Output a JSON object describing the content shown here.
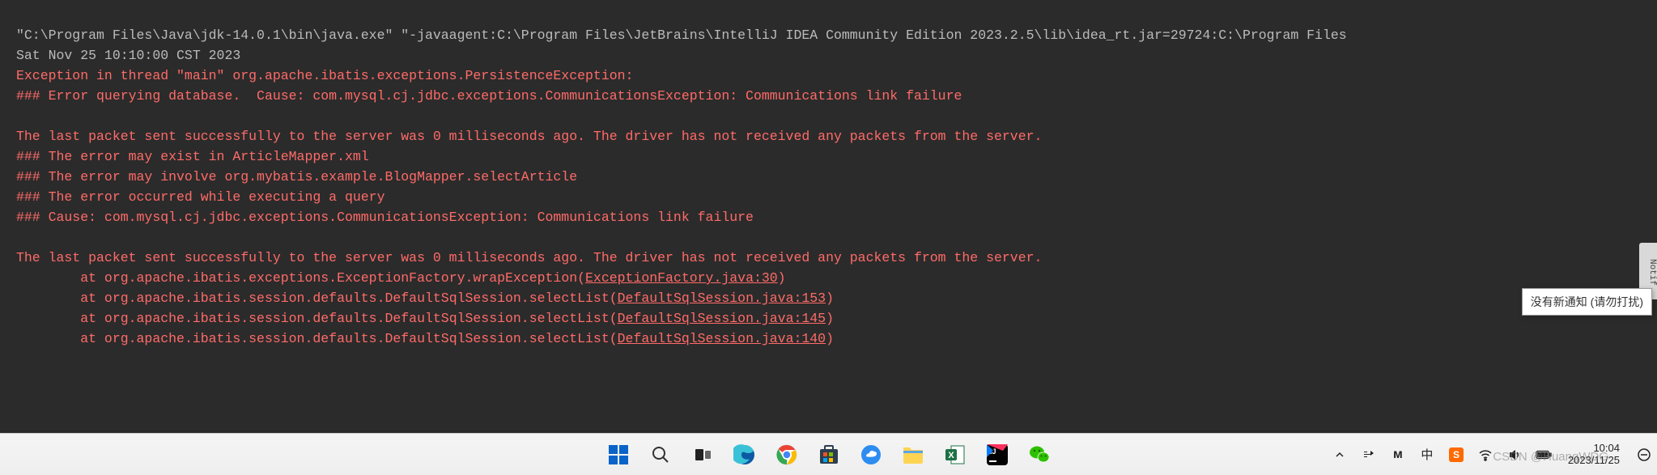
{
  "console": {
    "cmd": "\"C:\\Program Files\\Java\\jdk-14.0.1\\bin\\java.exe\" \"-javaagent:C:\\Program Files\\JetBrains\\IntelliJ IDEA Community Edition 2023.2.5\\lib\\idea_rt.jar=29724:C:\\Program Files",
    "ts": "Sat Nov 25 10:10:00 CST 2023",
    "err1": "Exception in thread \"main\" org.apache.ibatis.exceptions.PersistenceException: ",
    "err2": "### Error querying database.  Cause: com.mysql.cj.jdbc.exceptions.CommunicationsException: Communications link failure",
    "err3": "The last packet sent successfully to the server was 0 milliseconds ago. The driver has not received any packets from the server.",
    "err4": "### The error may exist in ArticleMapper.xml",
    "err5": "### The error may involve org.mybatis.example.BlogMapper.selectArticle",
    "err6": "### The error occurred while executing a query",
    "err7": "### Cause: com.mysql.cj.jdbc.exceptions.CommunicationsException: Communications link failure",
    "err8": "The last packet sent successfully to the server was 0 milliseconds ago. The driver has not received any packets from the server.",
    "trace": [
      {
        "pre": "\tat org.apache.ibatis.exceptions.ExceptionFactory.wrapException(",
        "link": "ExceptionFactory.java:30",
        "post": ")"
      },
      {
        "pre": "\tat org.apache.ibatis.session.defaults.DefaultSqlSession.selectList(",
        "link": "DefaultSqlSession.java:153",
        "post": ")"
      },
      {
        "pre": "\tat org.apache.ibatis.session.defaults.DefaultSqlSession.selectList(",
        "link": "DefaultSqlSession.java:145",
        "post": ")"
      },
      {
        "pre": "\tat org.apache.ibatis.session.defaults.DefaultSqlSession.selectList(",
        "link": "DefaultSqlSession.java:140",
        "post": ")"
      }
    ]
  },
  "tooltip": "没有新通知 (请勿打扰)",
  "notif_tab": "Notif",
  "tray": {
    "ime": "中",
    "time": "10:04",
    "date": "2023/11/25"
  },
  "watermark": "CSDN @HuangWDG"
}
